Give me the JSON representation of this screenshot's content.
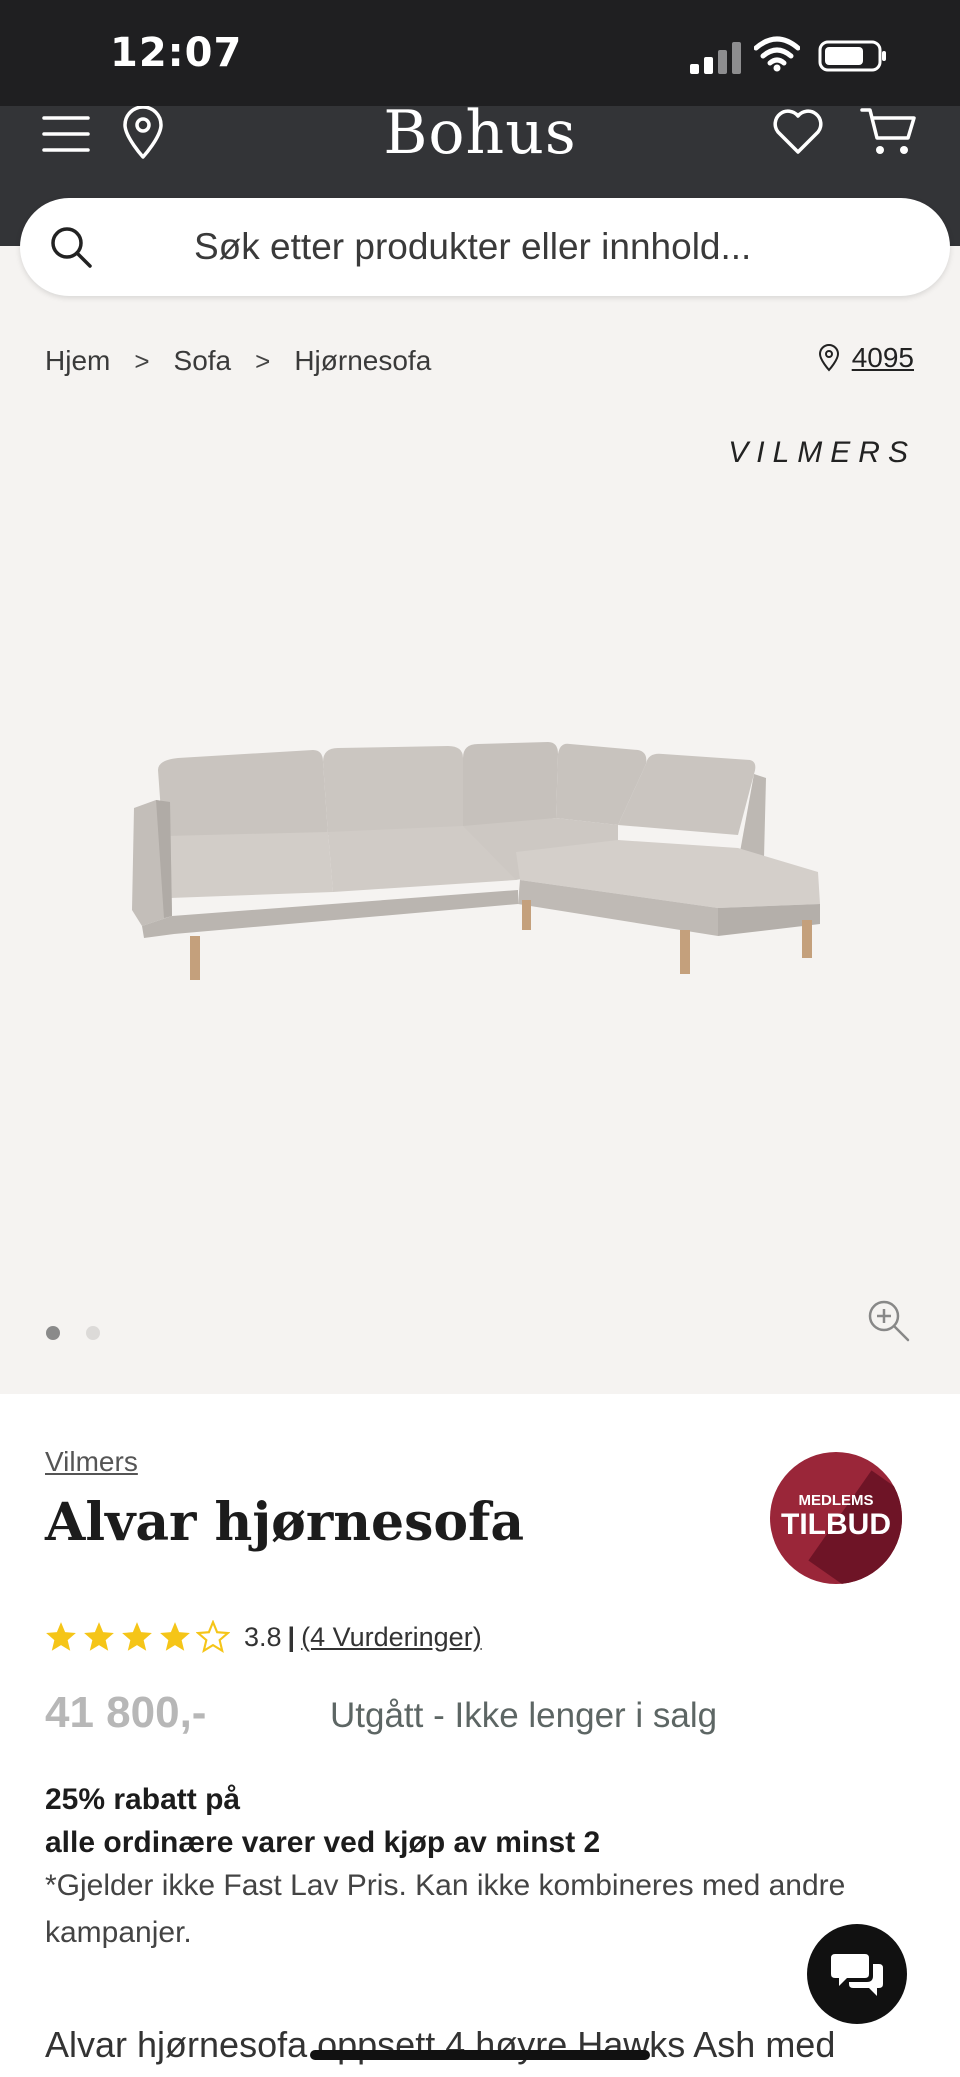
{
  "status_bar": {
    "time": "12:07"
  },
  "header": {
    "logo": "Bohus"
  },
  "search": {
    "placeholder": "Søk etter produkter eller innhold..."
  },
  "breadcrumb": {
    "items": [
      "Hjem",
      "Sofa",
      "Hjørnesofa"
    ],
    "separator": ">"
  },
  "location": {
    "postcode": "4095"
  },
  "gallery": {
    "brand_logo": "VILMERS",
    "image_count": 2,
    "active_index": 1
  },
  "product": {
    "brand": "Vilmers",
    "title": "Alvar hjørnesofa",
    "badge_top": "MEDLEMS",
    "badge_bottom": "TILBUD",
    "rating_value": "3.8",
    "rating_separator": "|",
    "reviews_label": "(4 Vurderinger)",
    "stars_filled": 4,
    "stars_total": 5,
    "price": "41 800,-",
    "availability": "Utgått - Ikke lenger i salg",
    "promo_line1": "25% rabatt på",
    "promo_line2": "alle ordinære varer ved kjøp av minst 2",
    "promo_note": "*Gjelder ikke Fast Lav Pris. Kan ikke kombineres med andre kampanjer.",
    "description_start": "Alvar hjørnesofa oppsett 4 høyre Hawks Ash med"
  },
  "colors": {
    "status_bar": "#1f1f21",
    "header": "#333437",
    "gallery_bg": "#f5f3f1",
    "badge": "#9a2639",
    "star": "#f5c518",
    "price": "#b7b7b7",
    "availability": "#5d6664"
  },
  "icons": [
    "signal-icon",
    "wifi-icon",
    "battery-icon",
    "menu-icon",
    "location-pin-icon",
    "heart-icon",
    "cart-icon",
    "search-icon",
    "chevron-right-icon",
    "zoom-in-icon",
    "star-icon",
    "chat-icon"
  ]
}
